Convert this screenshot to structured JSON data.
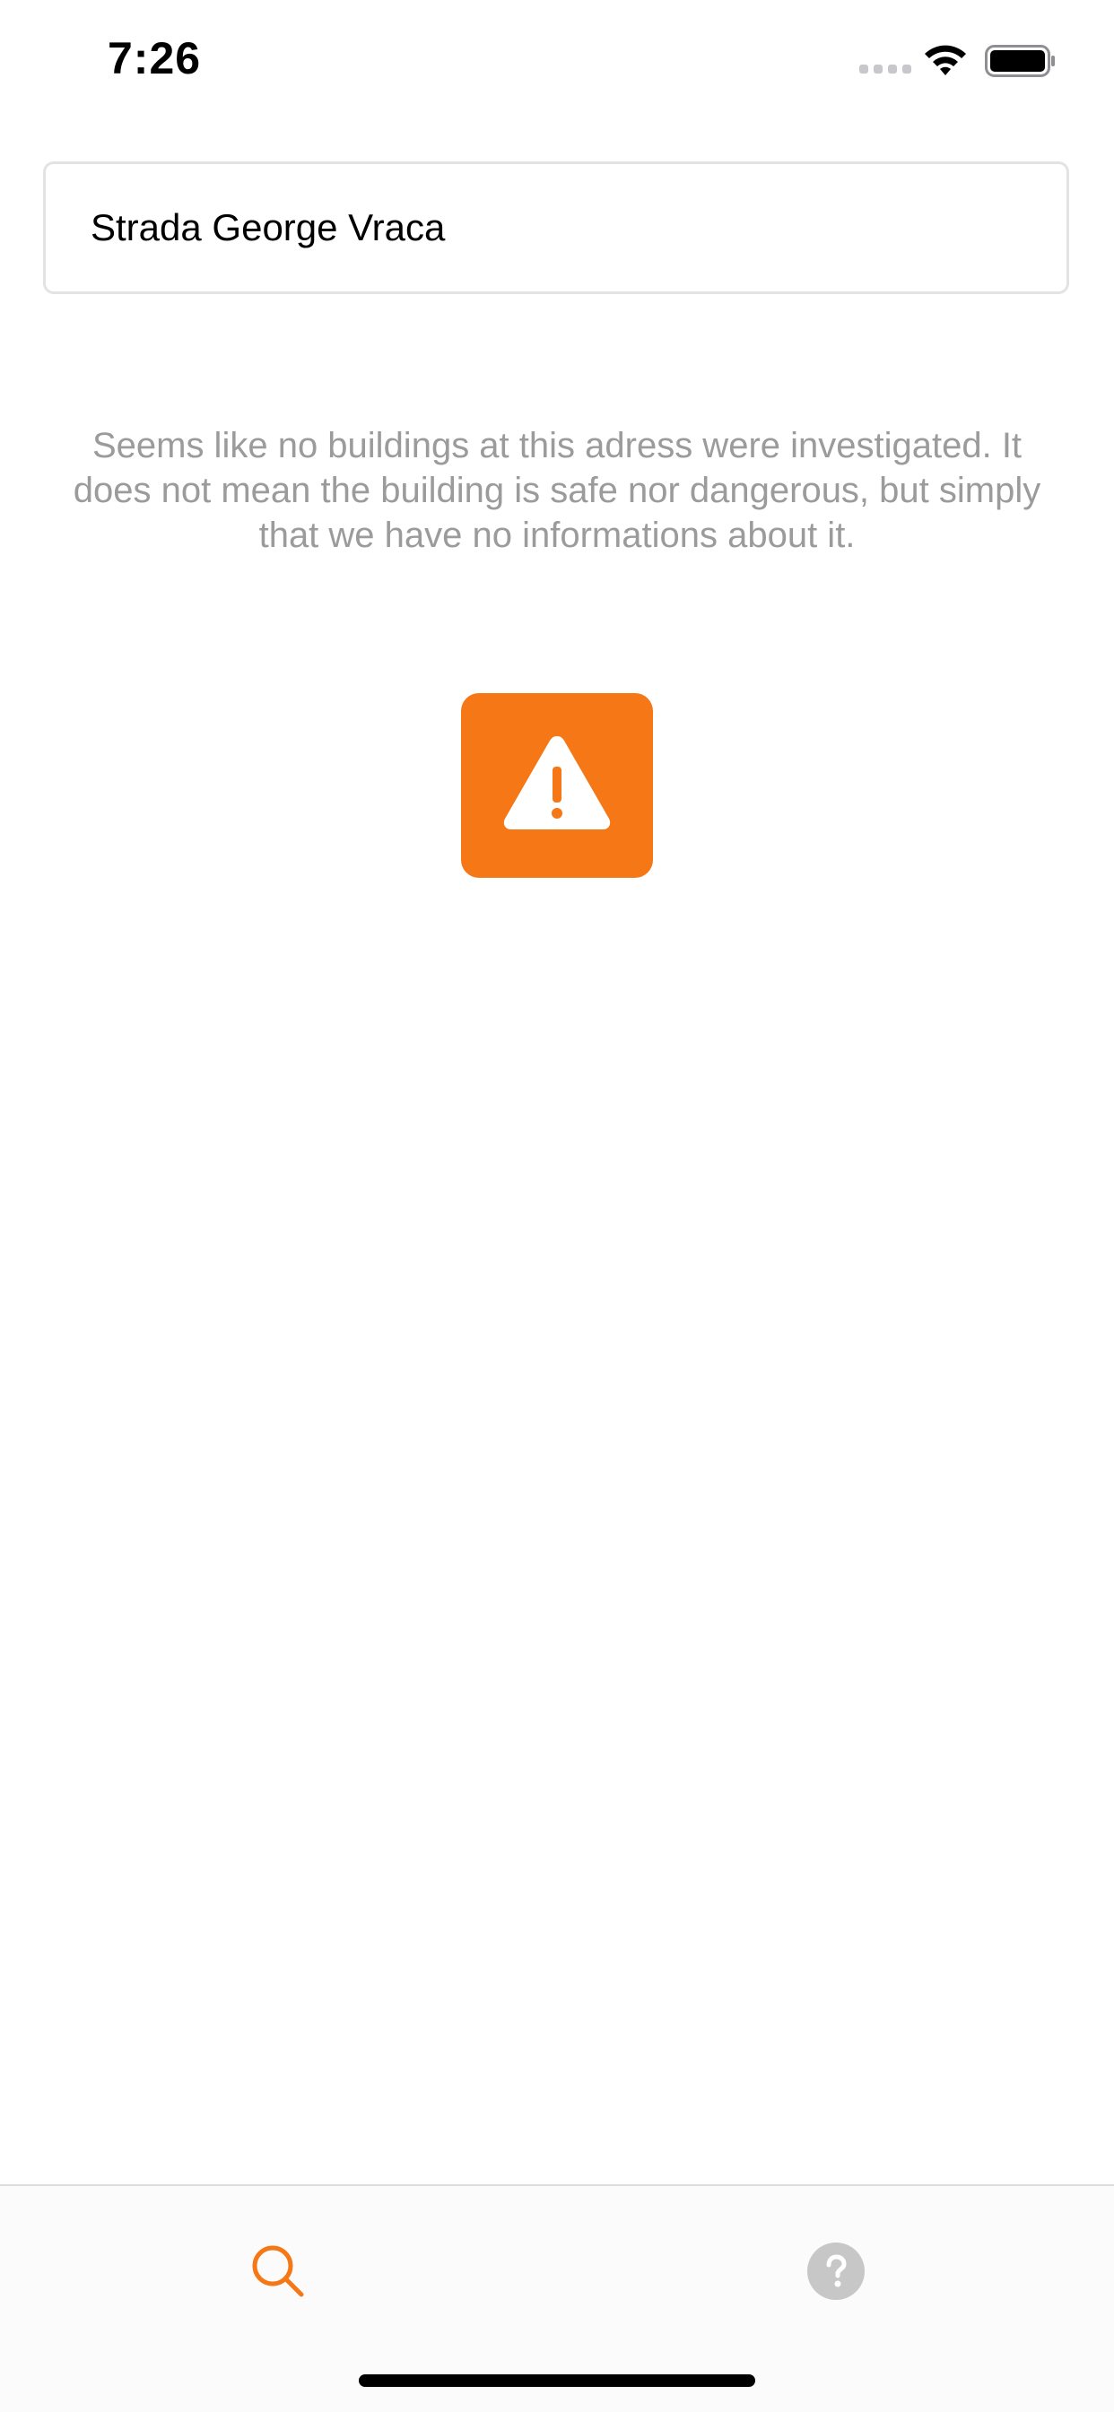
{
  "status_bar": {
    "time": "7:26",
    "icons": [
      "signal-dots-icon",
      "wifi-icon",
      "battery-icon"
    ]
  },
  "search": {
    "value": "Strada George Vraca",
    "placeholder": ""
  },
  "message": {
    "text": "Seems like no buildings at this adress were investigated. It does not mean the building is safe nor dangerous, but simply that we have no informations about it."
  },
  "warning": {
    "icon": "warning-triangle-icon",
    "color": "#f57716"
  },
  "tab_bar": {
    "tabs": [
      {
        "icon": "search-icon",
        "active": true,
        "color": "#f57716"
      },
      {
        "icon": "help-icon",
        "active": false,
        "color": "#c7c7c7"
      }
    ]
  },
  "colors": {
    "accent": "#f57716",
    "message_text": "#9b9b9b",
    "field_border": "#e3e3e6"
  }
}
